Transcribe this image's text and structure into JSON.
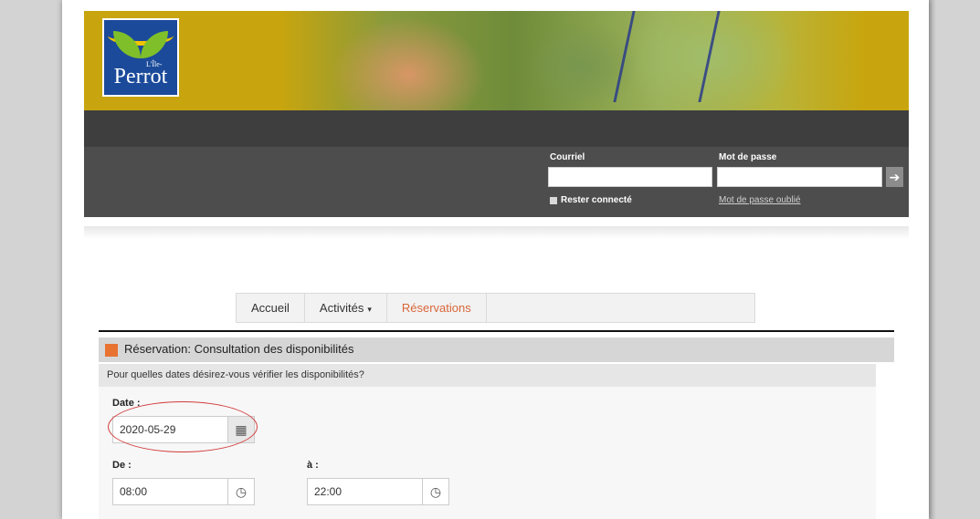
{
  "header": {
    "logo_text": "Perrot",
    "logo_sup": "L'Île-"
  },
  "login": {
    "email_label": "Courriel",
    "password_label": "Mot de passe",
    "email_value": "",
    "password_value": "",
    "remember_label": "Rester connecté",
    "forgot_link": "Mot de passe oublié",
    "submit_icon": "arrow-right-icon"
  },
  "nav": {
    "tabs": [
      {
        "label": "Accueil",
        "active": false
      },
      {
        "label": "Activités",
        "active": false,
        "has_dropdown": true
      },
      {
        "label": "Réservations",
        "active": true
      }
    ],
    "caret": "▾"
  },
  "reservation": {
    "title": "Réservation: Consultation des disponibilités",
    "question": "Pour quelles dates désirez-vous vérifier les disponibilités?",
    "date_label": "Date :",
    "date_value": "2020-05-29",
    "from_label": "De :",
    "from_value": "08:00",
    "to_label": "à :",
    "to_value": "22:00"
  },
  "colors": {
    "banner": "#c8a50e",
    "accent": "#e8722f",
    "active_tab": "#d9663a",
    "annotation": "#d23a3a"
  }
}
